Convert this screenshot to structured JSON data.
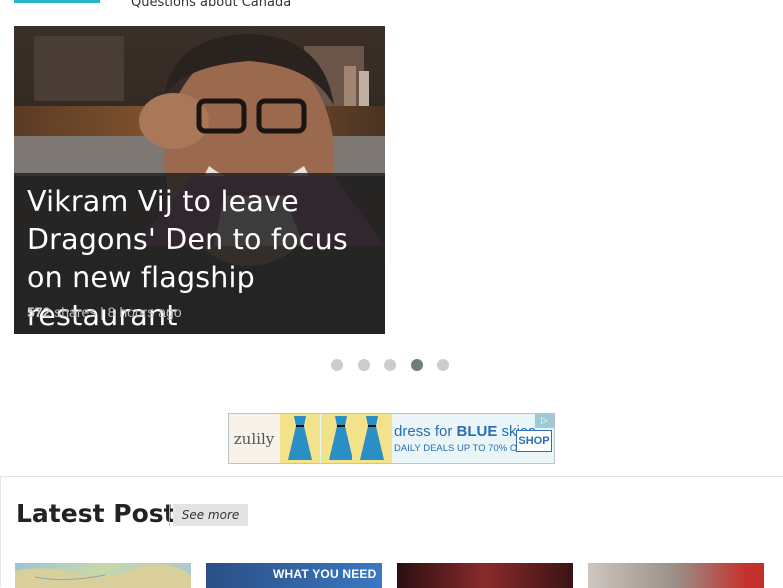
{
  "header": {
    "caption": "Questions about Canada"
  },
  "slider": {
    "title": "Vikram Vij to leave Dragons' Den to focus on new flagship restaurant",
    "shares": "572",
    "shares_suffix": " shares | 8 hours ago",
    "dots_count": 5,
    "active_dot": 4
  },
  "ad": {
    "logo": "zulily",
    "line1_prefix": "dress for ",
    "line1_bold": "BLUE",
    "line1_suffix": " skies",
    "line2": "DAILY DEALS UP TO 70% OFF",
    "shop": "SHOP"
  },
  "latest": {
    "title": "Latest Posts",
    "see_more": "See more",
    "thumbs": [
      {
        "caption": ""
      },
      {
        "caption": "WHAT YOU NEED"
      },
      {
        "caption": ""
      },
      {
        "caption": ""
      }
    ]
  },
  "colors": {
    "accent": "#2bb6c6",
    "dot_active": "#6e7e7c",
    "dot_inactive": "#c9cdcd",
    "ad_blue": "#2b6db5"
  }
}
